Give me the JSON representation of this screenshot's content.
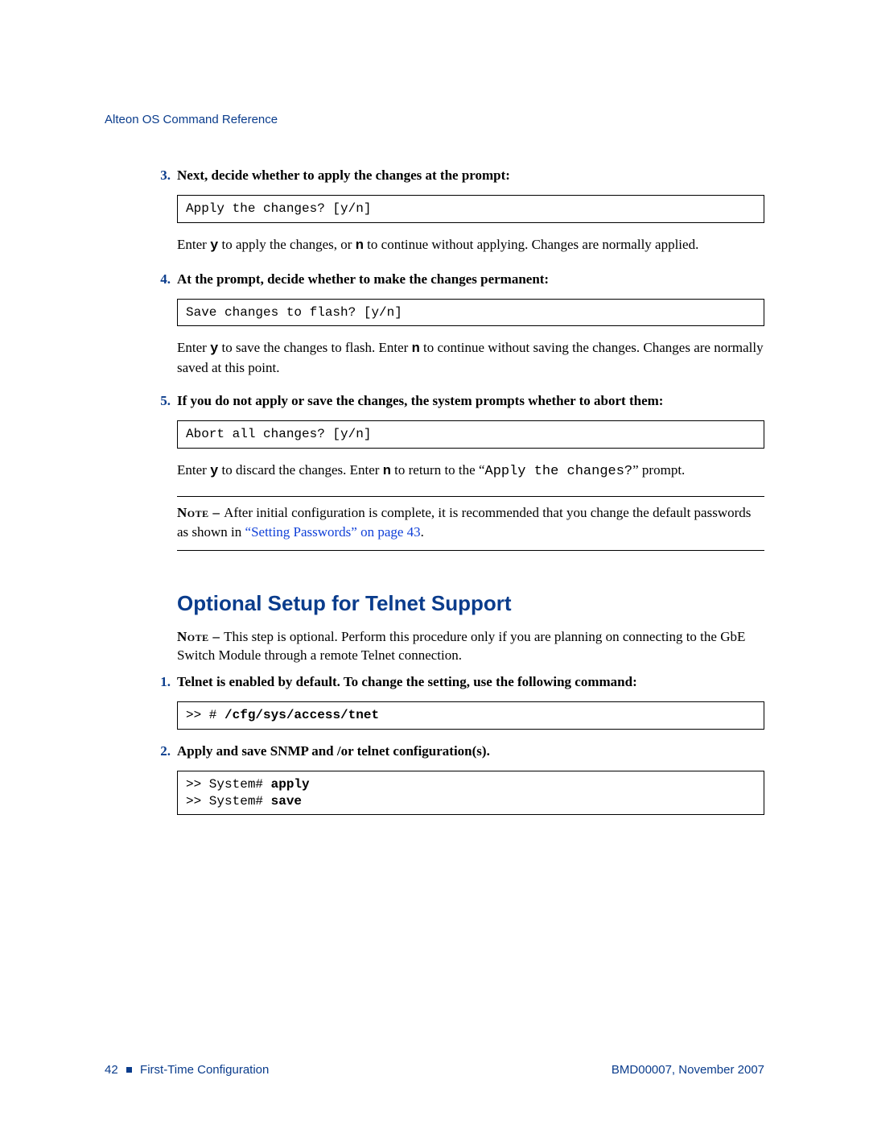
{
  "running_head": "Alteon OS Command Reference",
  "steps_a": [
    {
      "num": "3.",
      "title": "Next, decide whether to apply the changes at the prompt:",
      "code": "Apply the changes? [y/n]",
      "para_pre": "Enter ",
      "para_y": "y",
      "para_mid1": " to apply the changes, or ",
      "para_n": "n",
      "para_mid2": " to continue without applying. Changes are normally applied."
    },
    {
      "num": "4.",
      "title": "At the prompt, decide whether to make the changes permanent:",
      "code": "Save changes to flash? [y/n]",
      "para_pre": "Enter ",
      "para_y": "y",
      "para_mid1": " to save the changes to flash. Enter ",
      "para_n": "n",
      "para_mid2": " to continue without saving the changes. Changes are normally saved at this point."
    },
    {
      "num": "5.",
      "title": "If you do not apply or save the changes, the system prompts whether to abort them:",
      "code": "Abort all changes? [y/n]",
      "para_pre": "Enter ",
      "para_y": "y",
      "para_mid1": " to discard the changes. Enter ",
      "para_n": "n",
      "para_rest_a": " to return to the “",
      "para_tt": "Apply the changes?",
      "para_rest_b": "” prompt."
    }
  ],
  "note1": {
    "label": "Note – ",
    "text_a": "After initial configuration is complete, it is recommended that you change the default passwords as shown in ",
    "link": "“Setting Passwords” on page 43",
    "text_b": "."
  },
  "section_title": "Optional Setup for Telnet Support",
  "note2": {
    "label": "Note – ",
    "text": "This step is optional. Perform this procedure only if you are planning on connecting to the GbE Switch Module through a remote Telnet connection."
  },
  "steps_b": [
    {
      "num": "1.",
      "title": "Telnet is enabled by default. To change the setting, use the following command:",
      "code_pre": ">> # ",
      "code_cmd": "/cfg/sys/access/tnet"
    },
    {
      "num": "2.",
      "title": "Apply and save SNMP and /or telnet configuration(s).",
      "code_line1_pre": ">> System# ",
      "code_line1_cmd": "apply",
      "code_line2_pre": ">> System# ",
      "code_line2_cmd": "save"
    }
  ],
  "footer": {
    "page": "42",
    "chapter": "First-Time Configuration",
    "doc": "BMD00007, November 2007"
  }
}
